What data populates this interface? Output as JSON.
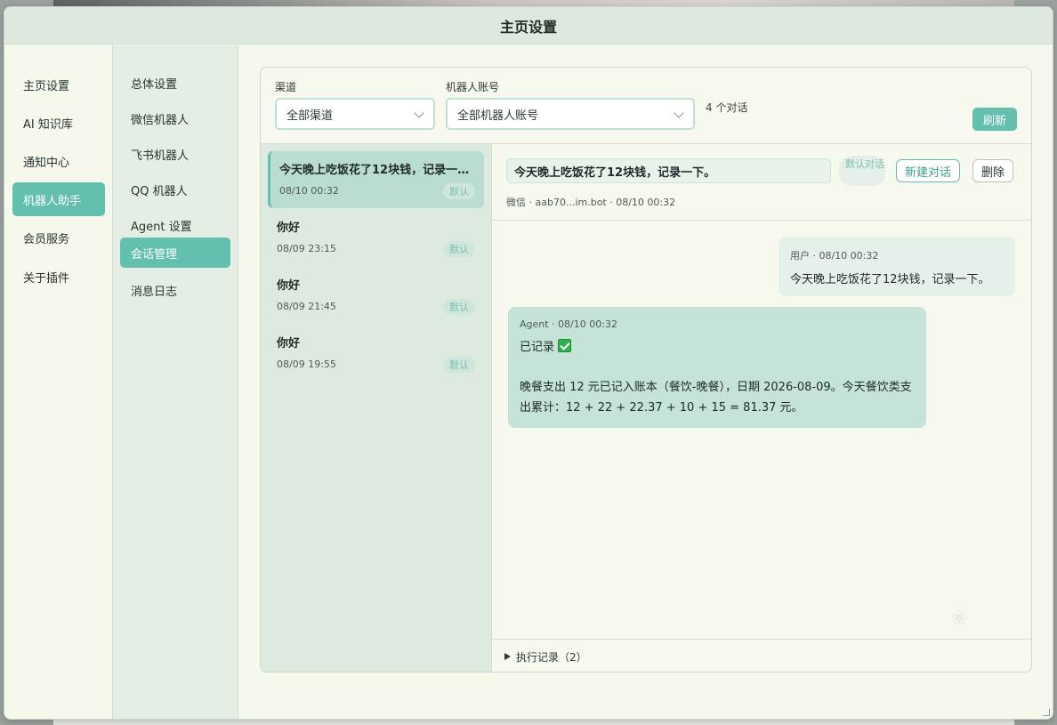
{
  "dialog": {
    "title": "主页设置"
  },
  "nav1": {
    "items": [
      {
        "label": "主页设置"
      },
      {
        "label": "AI 知识库"
      },
      {
        "label": "通知中心"
      },
      {
        "label": "机器人助手"
      },
      {
        "label": "会员服务"
      },
      {
        "label": "关于插件"
      }
    ],
    "active_index": 3
  },
  "nav2": {
    "items": [
      {
        "label": "总体设置"
      },
      {
        "label": "微信机器人"
      },
      {
        "label": "飞书机器人"
      },
      {
        "label": "QQ 机器人"
      },
      {
        "label": "Agent 设置"
      },
      {
        "label": "会话管理"
      },
      {
        "label": "消息日志"
      }
    ],
    "active_index": 5
  },
  "filters": {
    "channel_label": "渠道",
    "channel_value": "全部渠道",
    "account_label": "机器人账号",
    "account_value": "全部机器人账号",
    "count_text": "4 个对话",
    "refresh_label": "刷新"
  },
  "conversations": [
    {
      "title": "今天晚上吃饭花了12块钱，记录一下。",
      "time": "08/10 00:32",
      "badge": "默认"
    },
    {
      "title": "你好",
      "time": "08/09 23:15",
      "badge": "默认"
    },
    {
      "title": "你好",
      "time": "08/09 21:45",
      "badge": "默认"
    },
    {
      "title": "你好",
      "time": "08/09 19:55",
      "badge": "默认"
    }
  ],
  "chat": {
    "title": "今天晚上吃饭花了12块钱，记录一下。",
    "default_tag": "默认对话",
    "new_button": "新建对话",
    "delete_button": "删除",
    "meta": "微信 · aab70...im.bot · 08/10 00:32",
    "messages": [
      {
        "role": "user",
        "meta": "用户 · 08/10 00:32",
        "text": "今天晚上吃饭花了12块钱，记录一下。"
      },
      {
        "role": "agent",
        "meta": "Agent · 08/10 00:32",
        "text_head": "已记录",
        "text_body": "晚餐支出 12 元已记入账本（餐饮-晚餐），日期 2026-08-09。今天餐饮类支出累计：12 + 22 + 22.37 + 10 + 15 = 81.37 元。"
      }
    ],
    "exec_label": "执行记录（2）"
  },
  "icons": {
    "check": "check-icon",
    "chevron": "chevron-down-icon",
    "expand": "triangle-right-icon",
    "resize": "resize-handle-icon",
    "flower": "flower-icon"
  },
  "colors": {
    "accent": "#63bfae",
    "dialog_bg": "#f6f8ec",
    "list_bg": "#ddeadf"
  }
}
